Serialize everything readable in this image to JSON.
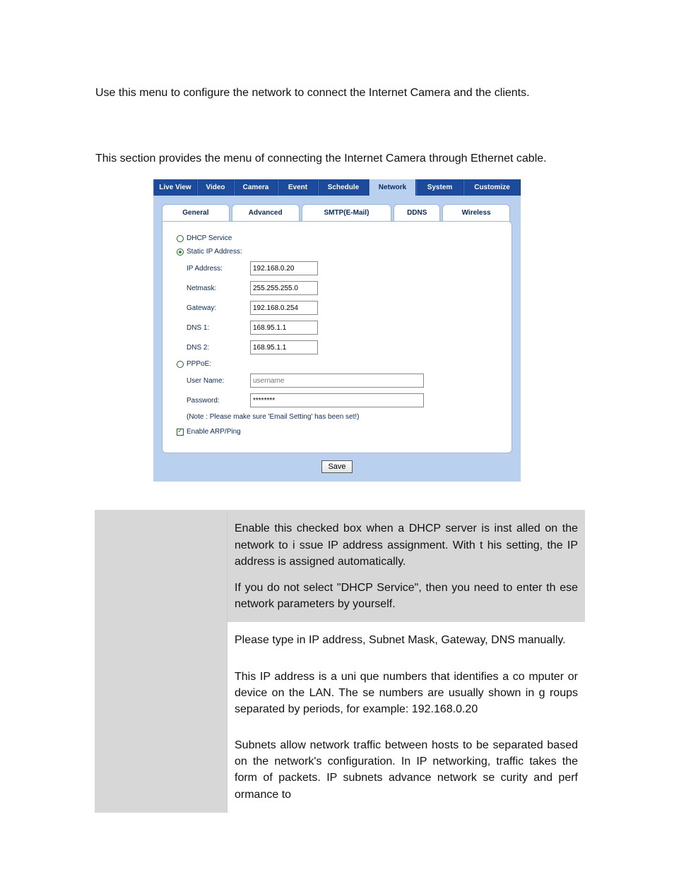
{
  "intro_para": "Use this menu to configure the network to connect the Internet Camera and the clients.",
  "general_para": "This section provides the menu of connecting the Internet Camera through Ethernet cable.",
  "ui": {
    "main_tabs": [
      "Live View",
      "Video",
      "Camera",
      "Event",
      "Schedule",
      "Network",
      "System",
      "Customize"
    ],
    "main_selected_index": 5,
    "sub_tabs": [
      "General",
      "Advanced",
      "SMTP(E-Mail)",
      "DDNS",
      "Wireless"
    ],
    "sub_selected_index": 0,
    "dhcp_label": "DHCP Service",
    "static_label": "Static IP Address:",
    "fields": {
      "ip_label": "IP Address:",
      "ip_value": "192.168.0.20",
      "netmask_label": "Netmask:",
      "netmask_value": "255.255.255.0",
      "gateway_label": "Gateway:",
      "gateway_value": "192.168.0.254",
      "dns1_label": "DNS 1:",
      "dns1_value": "168.95.1.1",
      "dns2_label": "DNS 2:",
      "dns2_value": "168.95.1.1"
    },
    "pppoe_label": "PPPoE:",
    "username_label": "User Name:",
    "username_placeholder": "username",
    "password_label": "Password:",
    "password_value": "********",
    "note": "(Note : Please make sure 'Email Setting' has been set!)",
    "arp_label": "Enable ARP/Ping",
    "save_label": "Save"
  },
  "desc": {
    "dhcp_p1": "Enable this checked box when a DHCP  server is inst alled on the network to i ssue IP address assignment. With t his setting, the IP address is assigned automatically.",
    "dhcp_p2": "If you do not  select \"DHCP Service\", then you  need to enter th ese network parameters by yourself.",
    "static_p1": "Please type in IP address, Subnet Mask, Gateway, DNS manually.",
    "ip_p1": "This IP address is a uni que numbers that identifies a co mputer or device on the LAN. The se numbers are usually shown in g roups separated by periods, for example: 192.168.0.20",
    "netmask_p1": "Subnets allow network traffic between hosts to be separated based on the network's configuration. In IP networking, traffic takes the form of packets. IP subnets advance network se curity and perf ormance to"
  }
}
